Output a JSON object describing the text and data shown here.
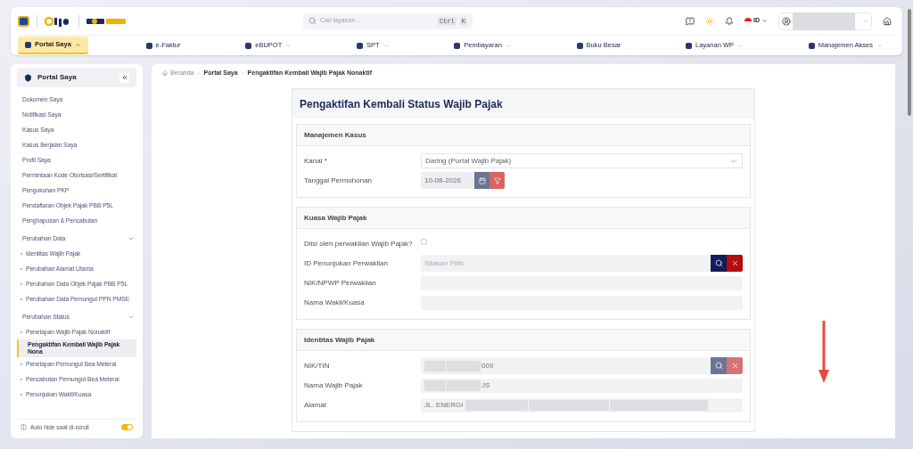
{
  "header": {
    "search": {
      "placeholder": "Cari layanan...",
      "shortcut": [
        "Ctrl",
        "K"
      ]
    },
    "language": "ID"
  },
  "nav": [
    {
      "label": "Portal Saya",
      "selected": true,
      "dropdown": true
    },
    {
      "label": "e-Faktur",
      "selected": false,
      "dropdown": false
    },
    {
      "label": "eBUPOT",
      "selected": false,
      "dropdown": true
    },
    {
      "label": "SPT",
      "selected": false,
      "dropdown": true
    },
    {
      "label": "Pembayaran",
      "selected": false,
      "dropdown": true
    },
    {
      "label": "Buku Besar",
      "selected": false,
      "dropdown": false
    },
    {
      "label": "Layanan WP",
      "selected": false,
      "dropdown": true
    },
    {
      "label": "Manajemen Akses",
      "selected": false,
      "dropdown": true
    }
  ],
  "sidebar": {
    "title": "Portal Saya",
    "items": [
      {
        "label": "Dokumen Saya",
        "selected": false
      },
      {
        "label": "Notifikasi Saya",
        "selected": false
      },
      {
        "label": "Kasus Saya",
        "selected": false
      },
      {
        "label": "Kasus Berjalan Saya",
        "selected": false
      },
      {
        "label": "Profil Saya",
        "selected": false
      },
      {
        "label": "Permintaan Kode Otorisasi/Sertifikat",
        "selected": false
      },
      {
        "label": "Pengukuhan PKP",
        "selected": false
      },
      {
        "label": "Pendaftaran Objek Pajak PBB P5L",
        "selected": false
      },
      {
        "label": "Penghapusan & Pencabutan",
        "selected": false
      },
      {
        "label": "Perubahan Data",
        "selected": false,
        "expanded": true,
        "children": [
          {
            "label": "Identitas Wajib Pajak",
            "selected": false
          },
          {
            "label": "Perubahan Alamat Utama",
            "selected": false
          },
          {
            "label": "Perubahan Data Objek Pajak PBB P5L",
            "selected": false
          },
          {
            "label": "Perubahan Data Pemungut PPN PMSE",
            "selected": false
          }
        ]
      },
      {
        "label": "Perubahan Status",
        "selected": false,
        "expanded": true,
        "children": [
          {
            "label": "Penetapan Wajib Pajak Nonaktif",
            "selected": false
          },
          {
            "label": "Pengaktifan Kembali Wajib Pajak Nona",
            "selected": true
          },
          {
            "label": "Penetapan Pemungut Bea Meterai",
            "selected": false
          },
          {
            "label": "Pencabutan Pemungut Bea Meterai",
            "selected": false
          },
          {
            "label": "Penunjukan Wakil/Kuasa",
            "selected": false
          }
        ]
      }
    ],
    "auto_hide": {
      "label": "Auto hide saat di-scroll",
      "on": true
    }
  },
  "breadcrumb": [
    "Beranda",
    "Portal Saya",
    "Pengaktifan Kembali Wajib Pajak Nonaktif"
  ],
  "form": {
    "title": "Pengaktifan Kembali Status Wajib Pajak",
    "sections": [
      {
        "title": "Manajemen Kasus",
        "fields": [
          {
            "kind": "select",
            "label": "Kanal *",
            "value": "Daring (Portal Wajib Pajak)"
          },
          {
            "kind": "date",
            "label": "Tanggal Permohonan",
            "value": "10-08-2026"
          }
        ]
      },
      {
        "title": "Kuasa Wajib Pajak",
        "fields": [
          {
            "kind": "checkbox",
            "label": "Diisi oleh perwakilan Wajib Pajak?",
            "checked": false
          },
          {
            "kind": "lookup",
            "label": "ID Penunjukan Perwakilan",
            "placeholder": "Silakan Pilih",
            "disabled": false
          },
          {
            "kind": "text",
            "label": "NIK/NPWP Perwakilan"
          },
          {
            "kind": "text",
            "label": "Nama Wakil/Kuasa"
          }
        ]
      },
      {
        "title": "Identitas Wajib Pajak",
        "fields": [
          {
            "kind": "lookup",
            "label": "NIK/TIN",
            "value": "009",
            "redacted": true,
            "disabled": true
          },
          {
            "kind": "text",
            "label": "Nama Wajib Pajak",
            "value": "JS",
            "redacted": true
          },
          {
            "kind": "text",
            "label": "Alamat",
            "value": "JL. ENERGI",
            "redacted_after": true
          }
        ]
      }
    ]
  }
}
